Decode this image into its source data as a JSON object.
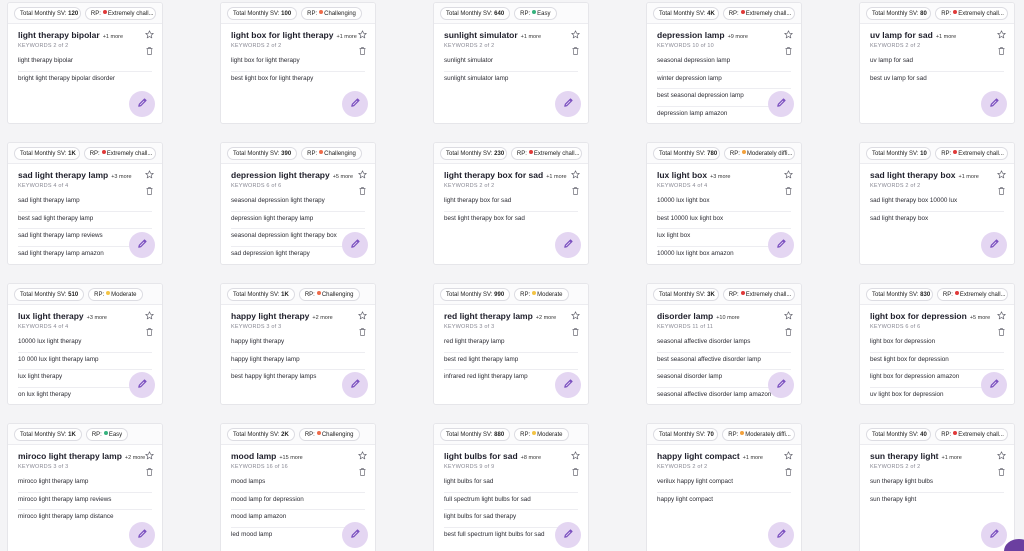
{
  "colors": {
    "extreme": "#e03a3a",
    "challenging": "#ef6b4a",
    "moderately": "#f2a13d",
    "moderate": "#f3c444",
    "easy": "#36b37e",
    "accent": "#7a4fbf"
  },
  "labels": {
    "sv_prefix": "Total Monthly SV:",
    "rp_prefix": "RP:",
    "keywords_prefix": "KEYWORDS"
  },
  "cards": [
    {
      "sv": "120",
      "rp": "Extremely chall...",
      "rp_level": "extreme",
      "title": "light therapy bipolar",
      "more": "+1 more",
      "kw_count": "2 of 2",
      "keywords": [
        "light therapy bipolar",
        "bright light therapy bipolar disorder"
      ]
    },
    {
      "sv": "100",
      "rp": "Challenging",
      "rp_level": "challenging",
      "title": "light box for light therapy",
      "more": "+1 more",
      "kw_count": "2 of 2",
      "keywords": [
        "light box for light therapy",
        "best light box for light therapy"
      ]
    },
    {
      "sv": "640",
      "rp": "Easy",
      "rp_level": "easy",
      "title": "sunlight simulator",
      "more": "+1 more",
      "kw_count": "2 of 2",
      "keywords": [
        "sunlight simulator",
        "sunlight simulator lamp"
      ]
    },
    {
      "sv": "4K",
      "rp": "Extremely chall...",
      "rp_level": "extreme",
      "title": "depression lamp",
      "more": "+9 more",
      "kw_count": "10 of 10",
      "keywords": [
        "seasonal depression lamp",
        "winter depression lamp",
        "best seasonal depression lamp",
        "depression lamp amazon"
      ]
    },
    {
      "sv": "80",
      "rp": "Extremely chall...",
      "rp_level": "extreme",
      "title": "uv lamp for sad",
      "more": "+1 more",
      "kw_count": "2 of 2",
      "keywords": [
        "uv lamp for sad",
        "best uv lamp for sad"
      ]
    },
    {
      "sv": "1K",
      "rp": "Extremely chall...",
      "rp_level": "extreme",
      "title": "sad light therapy lamp",
      "more": "+3 more",
      "kw_count": "4 of 4",
      "keywords": [
        "sad light therapy lamp",
        "best sad light therapy lamp",
        "sad light therapy lamp reviews",
        "sad light therapy lamp amazon"
      ]
    },
    {
      "sv": "390",
      "rp": "Challenging",
      "rp_level": "challenging",
      "title": "depression light therapy",
      "more": "+5 more",
      "kw_count": "6 of 6",
      "keywords": [
        "seasonal depression light therapy",
        "depression light therapy lamp",
        "seasonal depression light therapy box",
        "sad depression light therapy"
      ]
    },
    {
      "sv": "230",
      "rp": "Extremely chall...",
      "rp_level": "extreme",
      "title": "light therapy box for sad",
      "more": "+1 more",
      "kw_count": "2 of 2",
      "keywords": [
        "light therapy box for sad",
        "best light therapy box for sad"
      ]
    },
    {
      "sv": "780",
      "rp": "Moderately diffi...",
      "rp_level": "moderately",
      "title": "lux light box",
      "more": "+3 more",
      "kw_count": "4 of 4",
      "keywords": [
        "10000 lux light box",
        "best 10000 lux light box",
        "lux light box",
        "10000 lux light box amazon"
      ]
    },
    {
      "sv": "10",
      "rp": "Extremely chall...",
      "rp_level": "extreme",
      "title": "sad light therapy box",
      "more": "+1 more",
      "kw_count": "2 of 2",
      "keywords": [
        "sad light therapy box 10000 lux",
        "sad light therapy box"
      ]
    },
    {
      "sv": "510",
      "rp": "Moderate",
      "rp_level": "moderate",
      "title": "lux light therapy",
      "more": "+3 more",
      "kw_count": "4 of 4",
      "keywords": [
        "10000 lux light therapy",
        "10 000 lux light therapy lamp",
        "lux light therapy",
        "on lux light therapy"
      ]
    },
    {
      "sv": "1K",
      "rp": "Challenging",
      "rp_level": "challenging",
      "title": "happy light therapy",
      "more": "+2 more",
      "kw_count": "3 of 3",
      "keywords": [
        "happy light therapy",
        "happy light therapy lamp",
        "best happy light therapy lamps"
      ]
    },
    {
      "sv": "990",
      "rp": "Moderate",
      "rp_level": "moderate",
      "title": "red light therapy lamp",
      "more": "+2 more",
      "kw_count": "3 of 3",
      "keywords": [
        "red light therapy lamp",
        "best red light therapy lamp",
        "infrared red light therapy lamp"
      ]
    },
    {
      "sv": "3K",
      "rp": "Extremely chall...",
      "rp_level": "extreme",
      "title": "disorder lamp",
      "more": "+10 more",
      "kw_count": "11 of 11",
      "keywords": [
        "seasonal affective disorder lamps",
        "best seasonal affective disorder lamp",
        "seasonal disorder lamp",
        "seasonal affective disorder lamp amazon"
      ]
    },
    {
      "sv": "830",
      "rp": "Extremely chall...",
      "rp_level": "extreme",
      "title": "light box for depression",
      "more": "+5 more",
      "kw_count": "6 of 6",
      "keywords": [
        "light box for depression",
        "best light box for depression",
        "light box for depression amazon",
        "uv light box for depression"
      ]
    },
    {
      "sv": "1K",
      "rp": "Easy",
      "rp_level": "easy",
      "title": "miroco light therapy lamp",
      "more": "+2 more",
      "kw_count": "3 of 3",
      "keywords": [
        "miroco light therapy lamp",
        "miroco light therapy lamp reviews",
        "miroco light therapy lamp distance"
      ]
    },
    {
      "sv": "2K",
      "rp": "Challenging",
      "rp_level": "challenging",
      "title": "mood lamp",
      "more": "+15 more",
      "kw_count": "16 of 16",
      "keywords": [
        "mood lamps",
        "mood lamp for depression",
        "mood lamp amazon",
        "led mood lamp"
      ]
    },
    {
      "sv": "880",
      "rp": "Moderate",
      "rp_level": "moderate",
      "title": "light bulbs for sad",
      "more": "+8 more",
      "kw_count": "9 of 9",
      "keywords": [
        "light bulbs for sad",
        "full spectrum light bulbs for sad",
        "light bulbs for sad therapy",
        "best full spectrum light bulbs for sad"
      ]
    },
    {
      "sv": "70",
      "rp": "Moderately diffi...",
      "rp_level": "moderately",
      "title": "happy light compact",
      "more": "+1 more",
      "kw_count": "2 of 2",
      "keywords": [
        "verilux happy light compact",
        "happy light compact"
      ]
    },
    {
      "sv": "40",
      "rp": "Extremely chall...",
      "rp_level": "extreme",
      "title": "sun therapy light",
      "more": "+1 more",
      "kw_count": "2 of 2",
      "keywords": [
        "sun therapy light bulbs",
        "sun therapy light"
      ]
    }
  ]
}
